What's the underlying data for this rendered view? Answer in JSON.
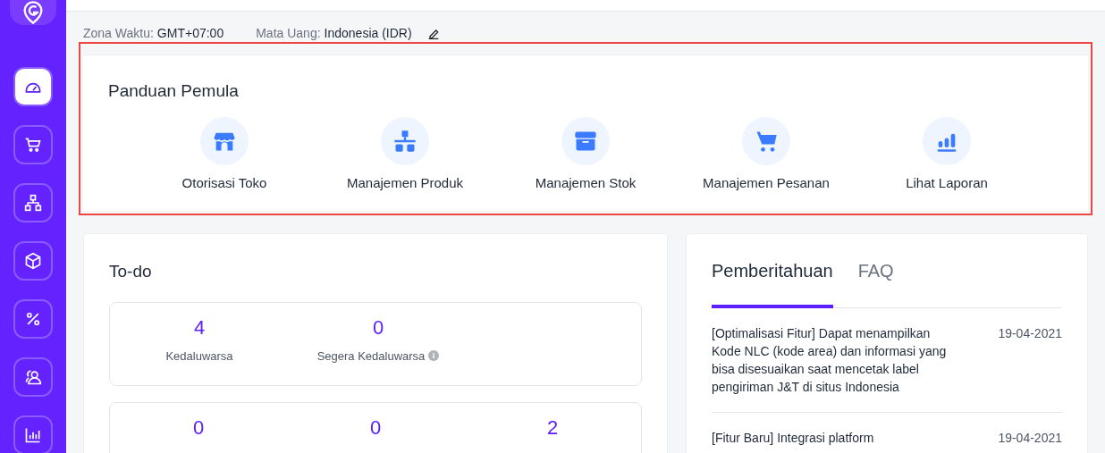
{
  "sidebar": {
    "items": [
      {
        "selected": true
      },
      {
        "selected": false
      },
      {
        "selected": false
      },
      {
        "selected": false
      },
      {
        "selected": false
      },
      {
        "selected": false
      },
      {
        "selected": false
      }
    ]
  },
  "info": [
    {
      "label": "Zona Waktu:",
      "value": "GMT+07:00",
      "editable": false
    },
    {
      "label": "Mata Uang:",
      "value": "Indonesia (IDR)",
      "editable": true
    }
  ],
  "guide": {
    "title": "Panduan Pemula",
    "items": [
      {
        "label": "Otorisasi Toko"
      },
      {
        "label": "Manajemen Produk"
      },
      {
        "label": "Manajemen Stok"
      },
      {
        "label": "Manajemen Pesanan"
      },
      {
        "label": "Lihat Laporan"
      }
    ]
  },
  "todo": {
    "title": "To-do",
    "groups": [
      {
        "stats": [
          {
            "value": "4",
            "label": "Kedaluwarsa",
            "info": false
          },
          {
            "value": "0",
            "label": "Segera Kedaluwarsa",
            "info": true
          }
        ]
      },
      {
        "stats": [
          {
            "value": "0"
          },
          {
            "value": "0"
          },
          {
            "value": "2"
          }
        ]
      }
    ]
  },
  "news": {
    "tabs": [
      {
        "label": "Pemberitahuan",
        "selected": true
      },
      {
        "label": "FAQ",
        "selected": false
      }
    ],
    "items": [
      {
        "text": "[Optimalisasi Fitur] Dapat menampilkan Kode NLC (kode area) dan informasi yang bisa disesuaikan saat mencetak label pengiriman J&T di situs Indonesia",
        "date": "19-04-2021"
      },
      {
        "text": "[Fitur Baru] Integrasi platform",
        "date": "19-04-2021"
      }
    ]
  }
}
